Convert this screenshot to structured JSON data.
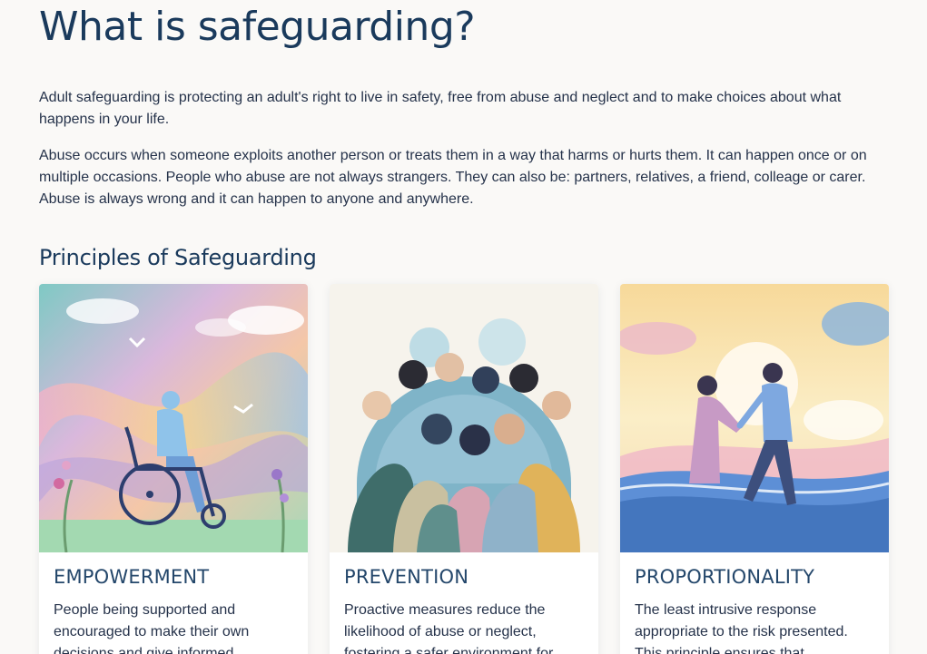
{
  "page": {
    "title": "What is safeguarding?",
    "paragraphs": [
      "Adult safeguarding is protecting an adult's right to live in safety, free from abuse and neglect and to make choices about what happens in your life.",
      "Abuse occurs when someone exploits another person or treats them in a way that harms or hurts them. It can happen once or on multiple occasions. People who abuse are not always strangers. They can also be: partners, relatives, a friend, colleage or carer. Abuse is always wrong and it can happen to anyone and anywhere."
    ],
    "section_title": "Principles of Safeguarding"
  },
  "cards": [
    {
      "title": "EMPOWERMENT",
      "text": "People being supported and encouraged to make their own decisions and give informed consent.",
      "image": "wheelchair-user-illustration"
    },
    {
      "title": "PREVENTION",
      "text": "Proactive measures reduce the likelihood of abuse or neglect, fostering a safer environment for all.",
      "image": "diverse-group-illustration"
    },
    {
      "title": "PROPORTIONALITY",
      "text": "The least intrusive response appropriate to the risk presented. This principle ensures that responses are fair.",
      "image": "helping-hand-illustration"
    }
  ],
  "colors": {
    "heading": "#1a3a5c",
    "body_text": "#25324a",
    "card_title": "#24476b",
    "background": "#faf9f7"
  }
}
